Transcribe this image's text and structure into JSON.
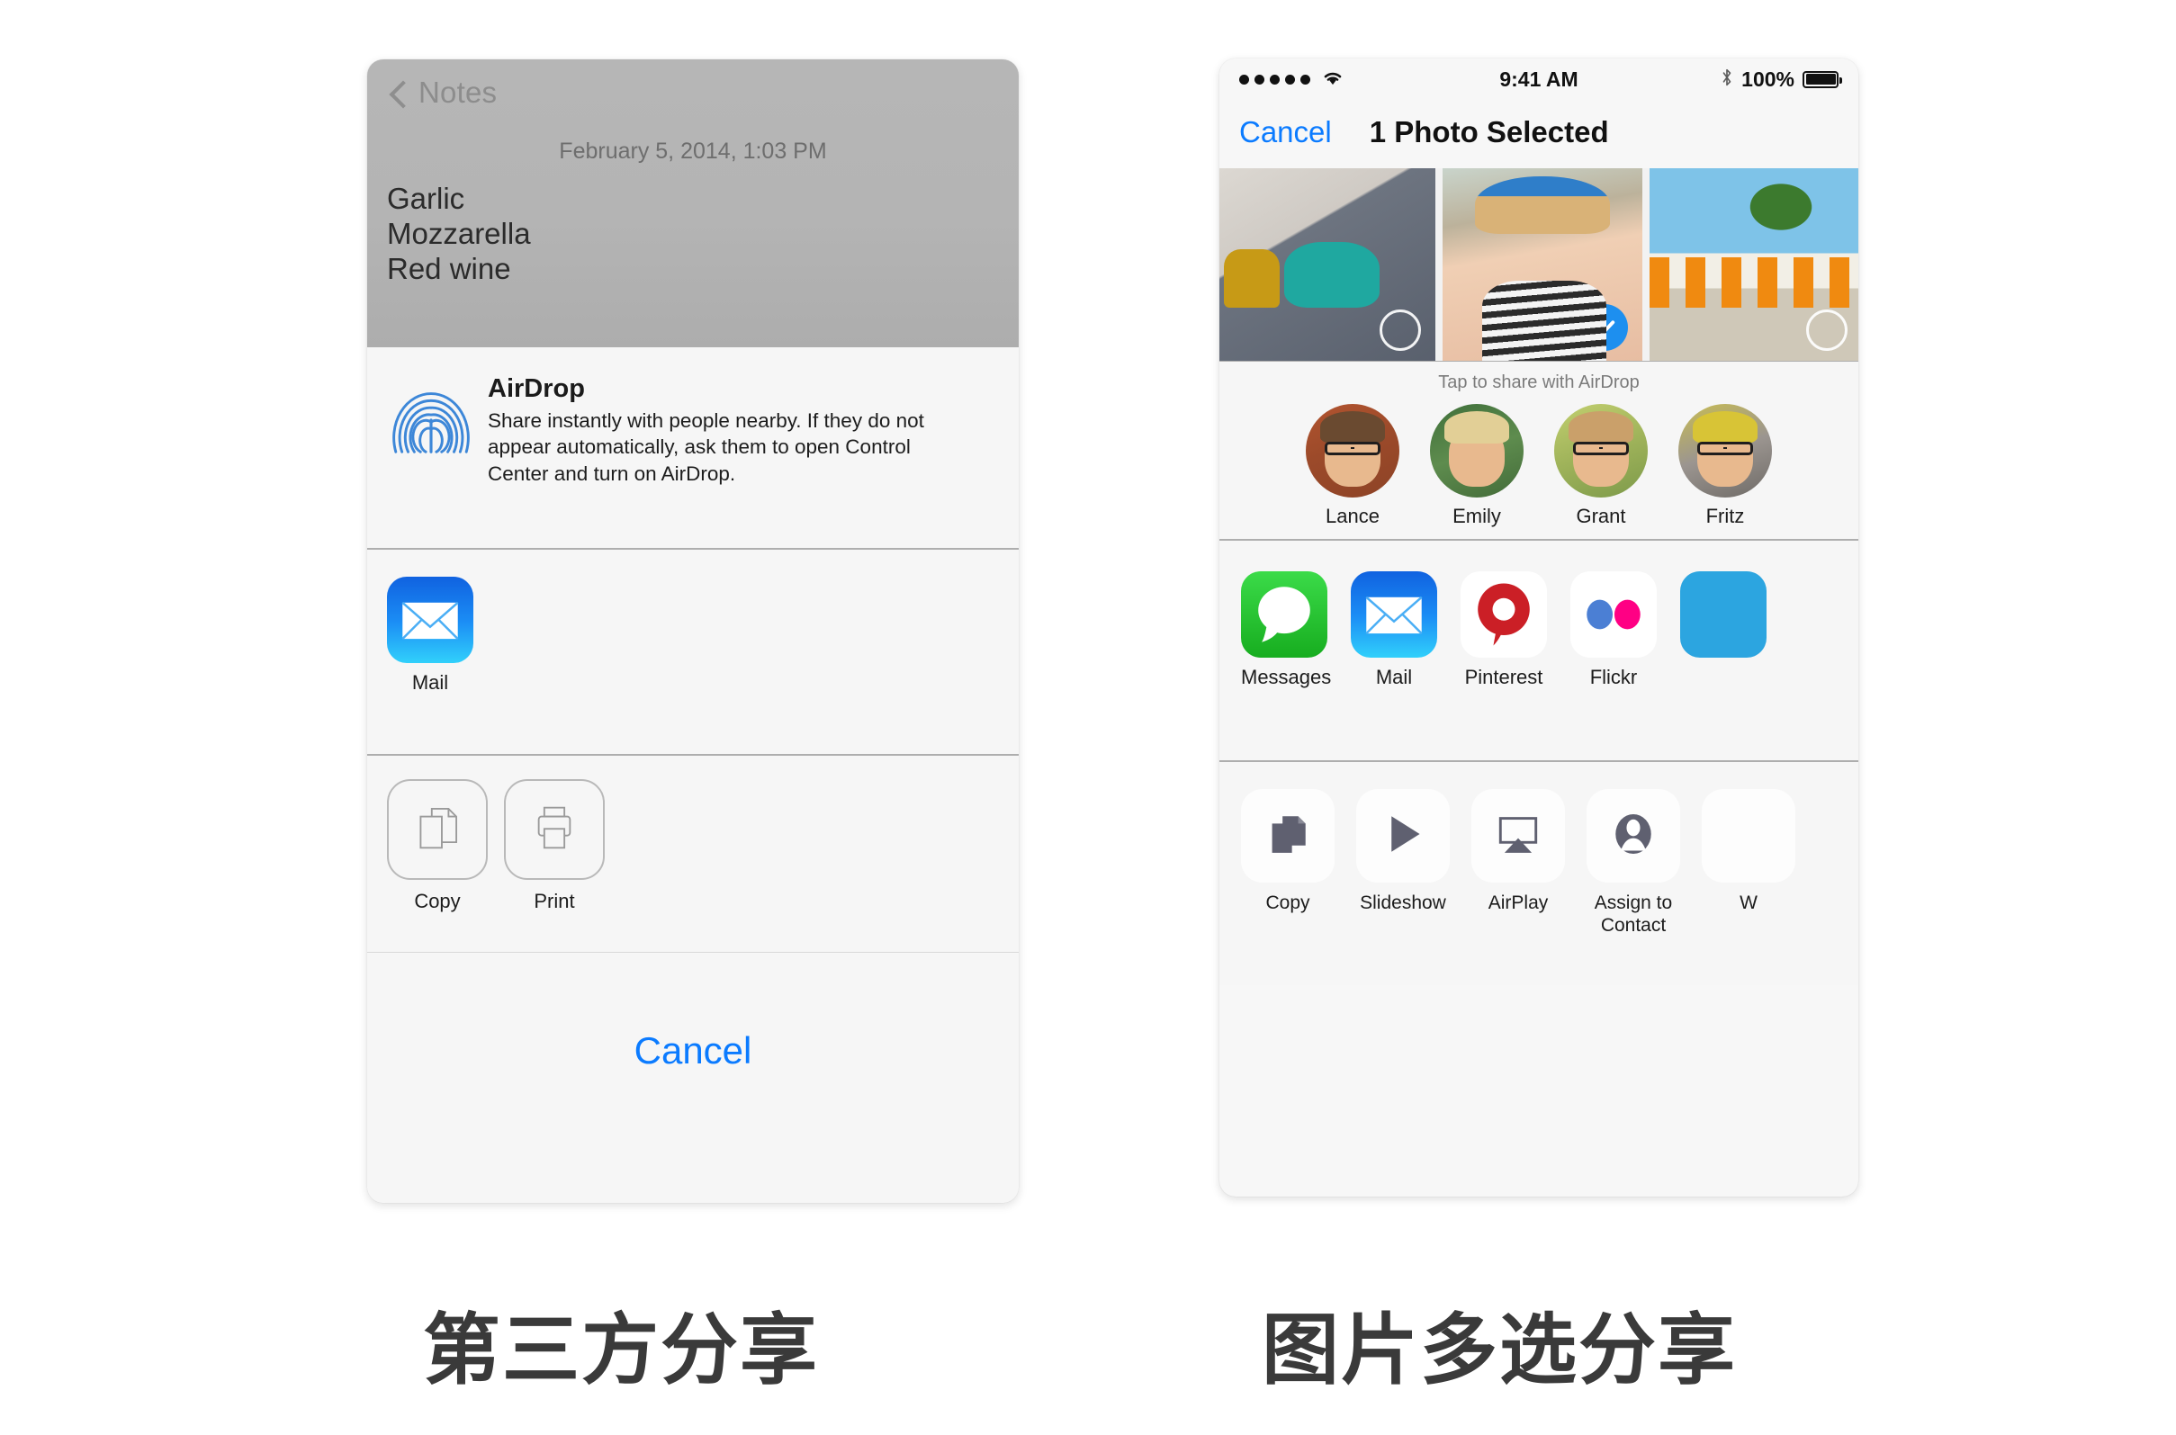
{
  "page": {
    "background": "#ffffff",
    "accent_blue": "#0b7bff"
  },
  "left_panel": {
    "caption": "第三方分享",
    "notes": {
      "back_label": "Notes",
      "date": "February 5, 2014, 1:03 PM",
      "lines": [
        "Garlic",
        "Mozzarella",
        "Red wine"
      ]
    },
    "airdrop": {
      "title": "AirDrop",
      "description": "Share instantly with people nearby. If they do not appear automatically, ask them to open Control Center and turn on AirDrop.",
      "icon": "airdrop-icon"
    },
    "apps": [
      {
        "label": "Mail",
        "icon": "mail-icon",
        "color": "#1478f0"
      }
    ],
    "actions": [
      {
        "label": "Copy",
        "icon": "copy-icon"
      },
      {
        "label": "Print",
        "icon": "print-icon"
      }
    ],
    "cancel_label": "Cancel"
  },
  "right_panel": {
    "caption": "图片多选分享",
    "status_bar": {
      "signal_dots": 5,
      "wifi": "wifi-icon",
      "time": "9:41 AM",
      "bluetooth": "bluetooth-icon",
      "battery_percent": "100%",
      "battery": "battery-icon"
    },
    "nav": {
      "cancel_label": "Cancel",
      "title": "1 Photo Selected"
    },
    "photos": [
      {
        "name": "beach-stairs-photo",
        "selected": false
      },
      {
        "name": "portrait-hat-photo",
        "selected": true
      },
      {
        "name": "santozeum-sign-photo",
        "selected": false
      }
    ],
    "airdrop_hint": "Tap to share with AirDrop",
    "people": [
      {
        "name": "Lance"
      },
      {
        "name": "Emily"
      },
      {
        "name": "Grant"
      },
      {
        "name": "Fritz"
      }
    ],
    "apps": [
      {
        "label": "Messages",
        "icon": "messages-icon",
        "color": "#22c032"
      },
      {
        "label": "Mail",
        "icon": "mail-icon",
        "color": "#1478f0"
      },
      {
        "label": "Pinterest",
        "icon": "pinterest-icon",
        "color": "#cb1f26"
      },
      {
        "label": "Flickr",
        "icon": "flickr-icon",
        "color": "#ff0084"
      },
      {
        "label": "",
        "icon": "twitter-icon",
        "color": "#2ca5e0"
      }
    ],
    "actions": [
      {
        "label": "Copy",
        "icon": "copy-icon"
      },
      {
        "label": "Slideshow",
        "icon": "play-icon"
      },
      {
        "label": "AirPlay",
        "icon": "airplay-icon"
      },
      {
        "label": "Assign to Contact",
        "icon": "person-icon"
      },
      {
        "label": "W",
        "icon": "wallpaper-icon"
      }
    ]
  }
}
